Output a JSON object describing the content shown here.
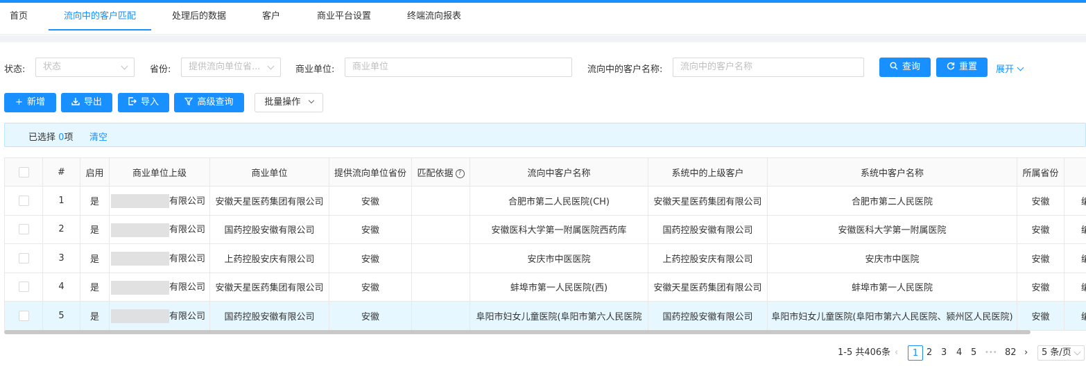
{
  "nav": {
    "tabs": [
      "首页",
      "流向中的客户匹配",
      "处理后的数据",
      "客户",
      "商业平台设置",
      "终端流向报表"
    ]
  },
  "filters": {
    "status_label": "状态:",
    "status_placeholder": "状态",
    "province_label": "省份:",
    "province_placeholder": "提供流向单位省...",
    "company_label": "商业单位:",
    "company_placeholder": "商业单位",
    "customer_label": "流向中的客户名称:",
    "customer_placeholder": "流向中的客户名称",
    "query_button": "查询",
    "reset_button": "重置",
    "expand": "展开"
  },
  "toolbar": {
    "add": "新增",
    "export": "导出",
    "import": "导入",
    "advanced": "高级查询",
    "batch": "批量操作"
  },
  "selection": {
    "prefix": "已选择",
    "count": "0",
    "suffix": "项",
    "clear": "清空"
  },
  "table": {
    "columns": [
      "#",
      "启用",
      "商业单位上级",
      "商业单位",
      "提供流向单位省份",
      "匹配依据",
      "流向中客户名称",
      "系统中的上级客户",
      "系统中客户名称",
      "所属省份"
    ],
    "rows": [
      {
        "idx": "1",
        "enabled": "是",
        "upper": "有限公司",
        "company": "安徽天星医药集团有限公司",
        "province": "安徽",
        "basis": "",
        "flow_customer": "合肥市第二人民医院(CH)",
        "sys_upper": "安徽天星医药集团有限公司",
        "sys_customer": "合肥市第二人民医院",
        "belong": "安徽",
        "op": "编"
      },
      {
        "idx": "2",
        "enabled": "是",
        "upper": "有限公司",
        "company": "国药控股安徽有限公司",
        "province": "安徽",
        "basis": "",
        "flow_customer": "安徽医科大学第一附属医院西药库",
        "sys_upper": "国药控股安徽有限公司",
        "sys_customer": "安徽医科大学第一附属医院",
        "belong": "安徽",
        "op": "编"
      },
      {
        "idx": "3",
        "enabled": "是",
        "upper": "有限公司",
        "company": "上药控股安庆有限公司",
        "province": "安徽",
        "basis": "",
        "flow_customer": "安庆市中医医院",
        "sys_upper": "上药控股安庆有限公司",
        "sys_customer": "安庆市中医院",
        "belong": "安徽",
        "op": "编"
      },
      {
        "idx": "4",
        "enabled": "是",
        "upper": "有限公司",
        "company": "安徽天星医药集团有限公司",
        "province": "安徽",
        "basis": "",
        "flow_customer": "蚌埠市第一人民医院(西)",
        "sys_upper": "安徽天星医药集团有限公司",
        "sys_customer": "蚌埠市第一人民医院",
        "belong": "安徽",
        "op": "编"
      },
      {
        "idx": "5",
        "enabled": "是",
        "upper": "有限公司",
        "company": "国药控股安徽有限公司",
        "province": "安徽",
        "basis": "",
        "flow_customer": "阜阳市妇女儿童医院(阜阳市第六人民医院",
        "sys_upper": "国药控股安徽有限公司",
        "sys_customer": "阜阳市妇女儿童医院(阜阳市第六人民医院、颍州区人民医院)",
        "belong": "安徽",
        "op": "编"
      }
    ]
  },
  "pagination": {
    "summary": "1-5 共406条",
    "pages": [
      "1",
      "2",
      "3",
      "4",
      "5"
    ],
    "ellipsis": "•••",
    "last": "82",
    "page_size": "5 条/页",
    "current": "1"
  },
  "colors": {
    "accent": "#1890ff",
    "selected_row": "#e6f7ff"
  }
}
